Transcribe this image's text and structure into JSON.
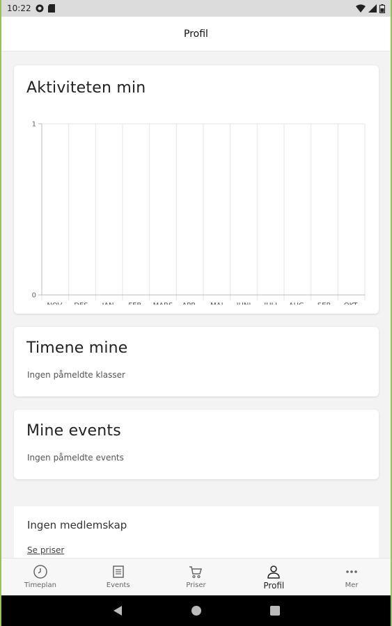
{
  "status_bar": {
    "time": "10:22"
  },
  "header": {
    "title": "Profil"
  },
  "activity": {
    "title": "Aktiviteten min"
  },
  "chart_data": {
    "type": "bar",
    "title": "Aktiviteten min",
    "categories": [
      "NOV.",
      "DES.",
      "JAN.",
      "FEB.",
      "MARS",
      "APR.",
      "MAI",
      "JUNI",
      "JULI",
      "AUG.",
      "SEP.",
      "OKT."
    ],
    "values": [
      0,
      0,
      0,
      0,
      0,
      0,
      0,
      0,
      0,
      0,
      0,
      0
    ],
    "yticks": [
      "0",
      "1"
    ],
    "ylim": [
      0,
      1
    ],
    "grid": true
  },
  "classes": {
    "title": "Timene mine",
    "empty_text": "Ingen påmeldte klasser"
  },
  "events": {
    "title": "Mine events",
    "empty_text": "Ingen påmeldte events"
  },
  "membership": {
    "title": "Ingen medlemskap",
    "link": "Se priser"
  },
  "nav": {
    "items": [
      {
        "label": "Timeplan",
        "icon": "clock-icon"
      },
      {
        "label": "Events",
        "icon": "list-icon"
      },
      {
        "label": "Priser",
        "icon": "cart-icon"
      },
      {
        "label": "Profil",
        "icon": "person-icon"
      },
      {
        "label": "Mer",
        "icon": "more-icon"
      }
    ],
    "active": "Profil"
  }
}
